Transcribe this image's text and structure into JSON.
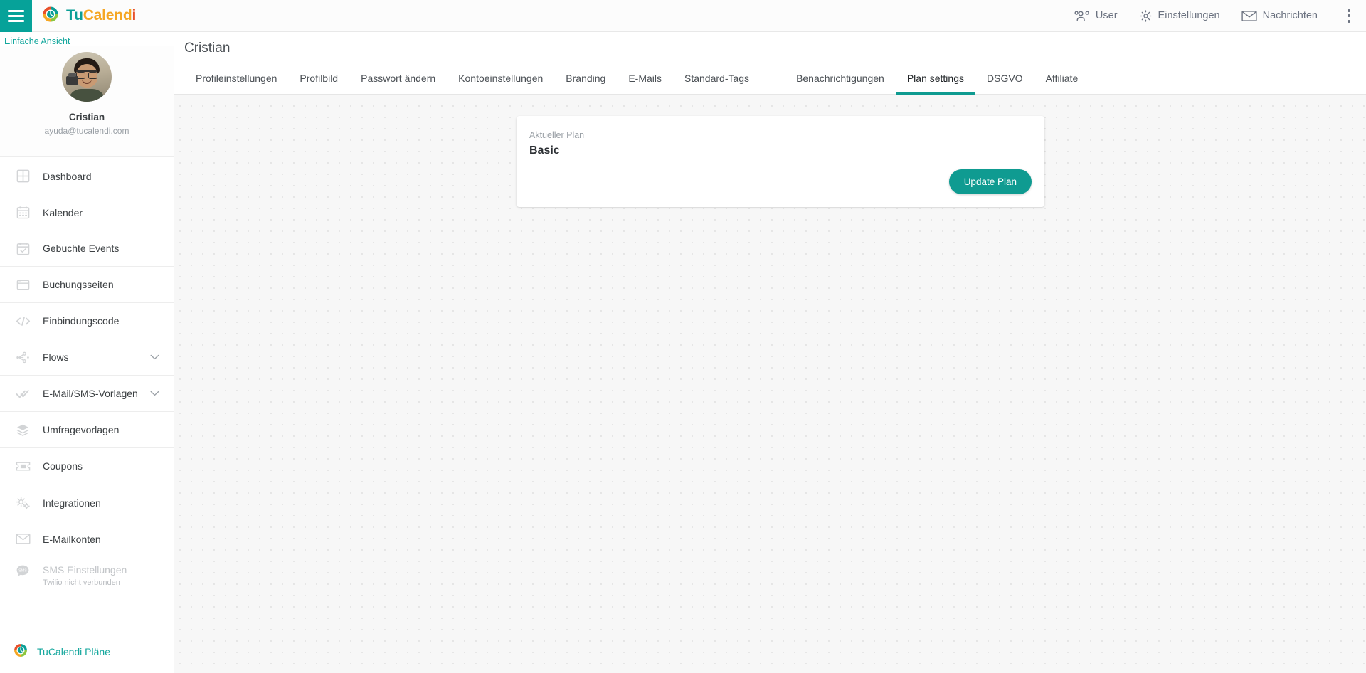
{
  "topbar": {
    "hamburger_label": "menu-toggle",
    "brand": {
      "part1": "Tu",
      "part2": "Calend",
      "part3": "",
      "part4": "i",
      "full": "TuCalendi"
    },
    "nav": [
      {
        "label": "User",
        "icon": "users-icon"
      },
      {
        "label": "Einstellungen",
        "icon": "gear-icon"
      },
      {
        "label": "Nachrichten",
        "icon": "envelope-icon"
      }
    ],
    "kebab": "more-vertical-icon"
  },
  "sidebar": {
    "simple_view": "Einfache Ansicht",
    "profile": {
      "name": "Cristian",
      "email": "ayuda@tucalendi.com"
    },
    "items": [
      {
        "label": "Dashboard",
        "icon": "grid-icon",
        "chevron": false,
        "sub": "",
        "muted": false
      },
      {
        "label": "Kalender",
        "icon": "calendar-icon",
        "chevron": false,
        "sub": "",
        "muted": false
      },
      {
        "label": "Gebuchte Events",
        "icon": "calendar-check-icon",
        "chevron": false,
        "sub": "",
        "muted": false
      },
      {
        "label": "Buchungsseiten",
        "icon": "browser-window-icon",
        "chevron": false,
        "sub": "",
        "muted": false
      },
      {
        "label": "Einbindungscode",
        "icon": "code-icon",
        "chevron": false,
        "sub": "",
        "muted": false
      },
      {
        "label": "Flows",
        "icon": "flow-nodes-icon",
        "chevron": true,
        "sub": "",
        "muted": false
      },
      {
        "label": "E-Mail/SMS-Vorlagen",
        "icon": "double-check-icon",
        "chevron": true,
        "sub": "",
        "muted": false
      },
      {
        "label": "Umfragevorlagen",
        "icon": "layers-icon",
        "chevron": false,
        "sub": "",
        "muted": false
      },
      {
        "label": "Coupons",
        "icon": "ticket-icon",
        "chevron": false,
        "sub": "",
        "muted": false
      },
      {
        "label": "Integrationen",
        "icon": "gears-icon",
        "chevron": false,
        "sub": "",
        "muted": false
      },
      {
        "label": "E-Mailkonten",
        "icon": "envelope-icon",
        "chevron": false,
        "sub": "",
        "muted": false
      },
      {
        "label": "SMS Einstellungen",
        "icon": "sms-bubble-icon",
        "chevron": false,
        "sub": "Twilio nicht verbunden",
        "muted": true
      }
    ],
    "footer": {
      "label": "TuCalendi Pläne",
      "icon": "tucalendi-logo-icon"
    }
  },
  "page": {
    "title": "Cristian",
    "tabs": [
      {
        "label": "Profileinstellungen",
        "active": false
      },
      {
        "label": "Profilbild",
        "active": false
      },
      {
        "label": "Passwort ändern",
        "active": false
      },
      {
        "label": "Kontoeinstellungen",
        "active": false
      },
      {
        "label": "Branding",
        "active": false
      },
      {
        "label": "E-Mails",
        "active": false
      },
      {
        "label": "Standard-Tags",
        "active": false
      },
      {
        "label": "Benachrichtigungen",
        "active": false
      },
      {
        "label": "Plan settings",
        "active": true
      },
      {
        "label": "DSGVO",
        "active": false
      },
      {
        "label": "Affiliate",
        "active": false
      }
    ]
  },
  "plan_card": {
    "label": "Aktueller Plan",
    "value": "Basic",
    "button": "Update Plan"
  },
  "colors": {
    "accent_teal": "#0f9b91",
    "topbar_teal": "#06a299",
    "brand_orange": "#f5a623",
    "brand_red": "#e8502a",
    "text_dark": "#3c4043",
    "text_muted": "#9aa0a6",
    "background": "#f7f7f7"
  }
}
